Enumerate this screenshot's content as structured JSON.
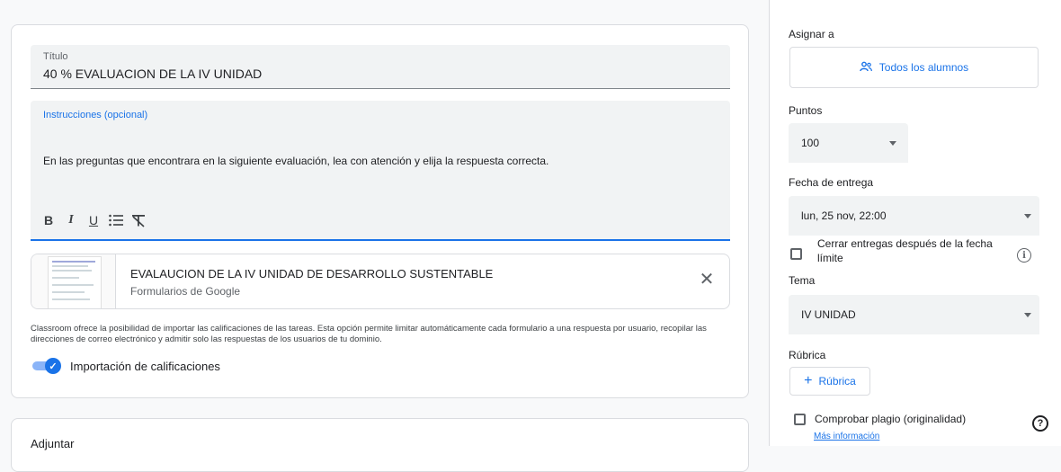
{
  "form": {
    "title_label": "Título",
    "title_value": "40 % EVALUACION DE LA IV UNIDAD",
    "instructions_label": "Instrucciones (opcional)",
    "instructions_text": "En las preguntas que encontrara en la siguiente evaluación, lea con atención  y elija la respuesta correcta.",
    "format_buttons": [
      "B",
      "I",
      "U",
      "bulleted-list-icon",
      "clear-format-icon"
    ]
  },
  "attachment": {
    "title": "EVALAUCION DE LA IV UNIDAD DE DESARROLLO SUSTENTABLE",
    "subtitle": "Formularios de Google",
    "close": "✕"
  },
  "grades": {
    "note": "Classroom ofrece la posibilidad de importar las calificaciones de las tareas. Esta opción permite limitar automáticamente cada formulario a una respuesta por usuario, recopilar las direcciones de correo electrónico y admitir solo las respuestas de los usuarios de tu dominio.",
    "toggle_label": "Importación de calificaciones",
    "toggle_on": true
  },
  "attach_section": {
    "label": "Adjuntar"
  },
  "sidebar": {
    "assign_label": "Asignar a",
    "assign_value": "Todos los alumnos",
    "points_label": "Puntos",
    "points_value": "100",
    "due_label": "Fecha de entrega",
    "due_value": "lun, 25 nov, 22:00",
    "close_submissions": "Cerrar entregas después de la fecha límite",
    "topic_label": "Tema",
    "topic_value": "IV UNIDAD",
    "rubric_label": "Rúbrica",
    "rubric_button": "Rúbrica",
    "plagiarism": "Comprobar plagio (originalidad)",
    "more_info": "Más información"
  },
  "colors": {
    "accent": "#1a73e8",
    "field_bg": "#f1f3f4",
    "border": "#dadce0"
  }
}
